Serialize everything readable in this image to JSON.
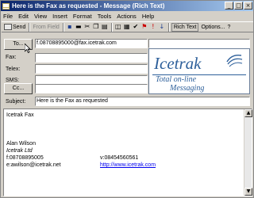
{
  "window": {
    "title": "Here is the Fax as requested - Message (Rich Text)"
  },
  "window_controls": {
    "minimize": "_",
    "maximize": "□",
    "close": "×"
  },
  "menu": [
    "File",
    "Edit",
    "View",
    "Insert",
    "Format",
    "Tools",
    "Actions",
    "Help"
  ],
  "toolbar": {
    "send": "Send",
    "from_field": "From Field",
    "format": "Rich Text",
    "options": "Options...",
    "help": "?"
  },
  "header": {
    "to_button": "To...",
    "to_value": "f.08708895000@fax.icetrak.com",
    "fax_label": "Fax:",
    "telex_label": "Telex:",
    "sms_label": "SMS:",
    "cc_button": "Cc...",
    "subject_label": "Subject:",
    "subject_value": "Here is the Fax as requested"
  },
  "logo": {
    "brand": "Icetrak",
    "tagline_line1": "Total on-line",
    "tagline_line2": "Messaging"
  },
  "body": {
    "line1": "Icetrak Fax",
    "name": "Alan Wilson",
    "company": "Icetrak Ltd",
    "fax": "f:08708895005",
    "voice": "v:08454560561",
    "email": "e:awilson@icetrak.net",
    "website": "http://www.icetrak.com"
  },
  "scrollbar": {
    "up": "▲",
    "down": "▼"
  },
  "colors": {
    "titlebar": "#0a246a",
    "brand": "#2d5f9a",
    "link": "#0000ee"
  }
}
